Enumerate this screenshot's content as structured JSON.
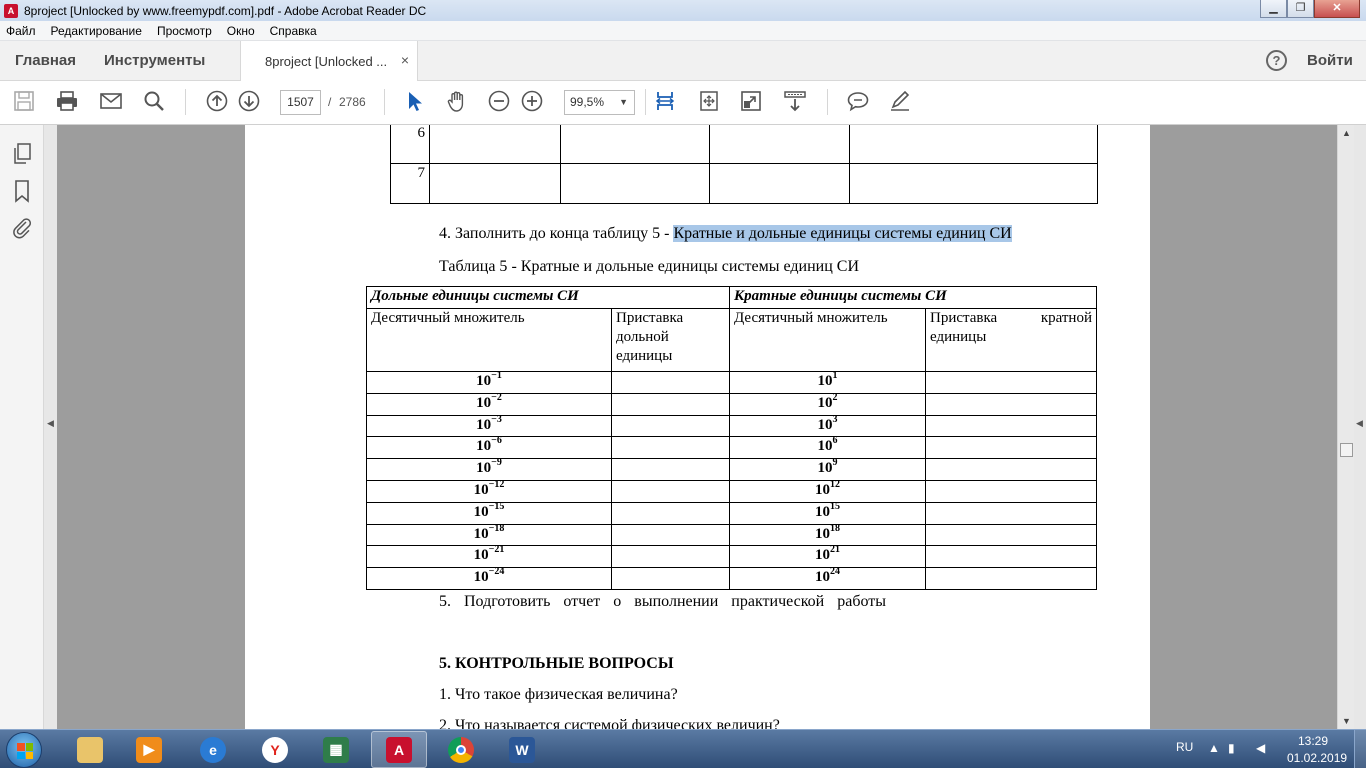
{
  "window": {
    "title": "8project [Unlocked by www.freemypdf.com].pdf - Adobe Acrobat Reader DC",
    "app_icon_label": "A",
    "minimize": "▁",
    "maximize": "❐",
    "close": "✕"
  },
  "menu": [
    "Файл",
    "Редактирование",
    "Просмотр",
    "Окно",
    "Справка"
  ],
  "tabs": {
    "home": "Главная",
    "tools": "Инструменты",
    "document": "8project [Unlocked ...",
    "close": "×",
    "help": "?",
    "signin": "Войти"
  },
  "toolbar": {
    "page_current": "1507",
    "page_separator": "/",
    "page_total": "2786",
    "zoom": "99,5%",
    "zoom_caret": "▼",
    "icons": [
      "save-icon",
      "print-icon",
      "email-icon",
      "search-icon",
      "prev-page-icon",
      "next-page-icon",
      "select-cursor-icon",
      "hand-icon",
      "zoom-out-icon",
      "zoom-in-icon",
      "fit-width-icon",
      "fit-page-icon",
      "fullscreen-icon",
      "scroll-mode-icon",
      "comment-icon",
      "sign-icon"
    ]
  },
  "left_pane": {
    "icons": [
      "page-thumbnails-icon",
      "bookmarks-icon",
      "attachments-icon"
    ],
    "collapse_arrow": "◀"
  },
  "right_pane": {
    "expand_arrow": "◀",
    "scroll_up": "▲",
    "scroll_down": "▼"
  },
  "document": {
    "top_table_rows": [
      "6",
      "7"
    ],
    "task4_prefix": "4. Заполнить до конца таблицу 5 -",
    "task4_highlight": "Кратные и дольные единицы системы единиц СИ",
    "table_caption_prefix": "Таблица 5",
    "table_caption_rest": "- Кратные и дольные единицы системы единиц СИ",
    "table": {
      "header_left": "Дольные единицы системы СИ",
      "header_right": "Кратные единицы системы СИ",
      "sub_decimal_left": "Десятичный множитель",
      "sub_prefix_left": "Приставка дольной единицы",
      "sub_decimal_right": "Десятичный множитель",
      "sub_prefix_right": "Приставка кратной единицы",
      "rows": [
        {
          "d_base": "10",
          "d_exp": "−1",
          "m_base": "10",
          "m_exp": "1"
        },
        {
          "d_base": "10",
          "d_exp": "−2",
          "m_base": "10",
          "m_exp": "2"
        },
        {
          "d_base": "10",
          "d_exp": "−3",
          "m_base": "10",
          "m_exp": "3"
        },
        {
          "d_base": "10",
          "d_exp": "−6",
          "m_base": "10",
          "m_exp": "6"
        },
        {
          "d_base": "10",
          "d_exp": "−9",
          "m_base": "10",
          "m_exp": "9"
        },
        {
          "d_base": "10",
          "d_exp": "−12",
          "m_base": "10",
          "m_exp": "12"
        },
        {
          "d_base": "10",
          "d_exp": "−15",
          "m_base": "10",
          "m_exp": "15"
        },
        {
          "d_base": "10",
          "d_exp": "−18",
          "m_base": "10",
          "m_exp": "18"
        },
        {
          "d_base": "10",
          "d_exp": "−21",
          "m_base": "10",
          "m_exp": "21"
        },
        {
          "d_base": "10",
          "d_exp": "−24",
          "m_base": "10",
          "m_exp": "24"
        }
      ]
    },
    "task5": "5. Подготовить отчет о выполнении практической работы",
    "section5": "5. КОНТРОЛЬНЫЕ ВОПРОСЫ",
    "q1": "1. Что такое физическая величина?",
    "q2": "2. Что называется системой физических величин?"
  },
  "taskbar": {
    "apps": [
      "explorer",
      "media-player",
      "internet-explorer",
      "yandex-browser",
      "spreadsheet",
      "acrobat-reader",
      "chrome",
      "word"
    ],
    "lang": "RU",
    "time": "13:29",
    "date": "01.02.2019"
  },
  "colors": {
    "highlight": "#a8c7e8",
    "doc_background": "#9d9d9d",
    "acrobat_red": "#c8102e"
  }
}
